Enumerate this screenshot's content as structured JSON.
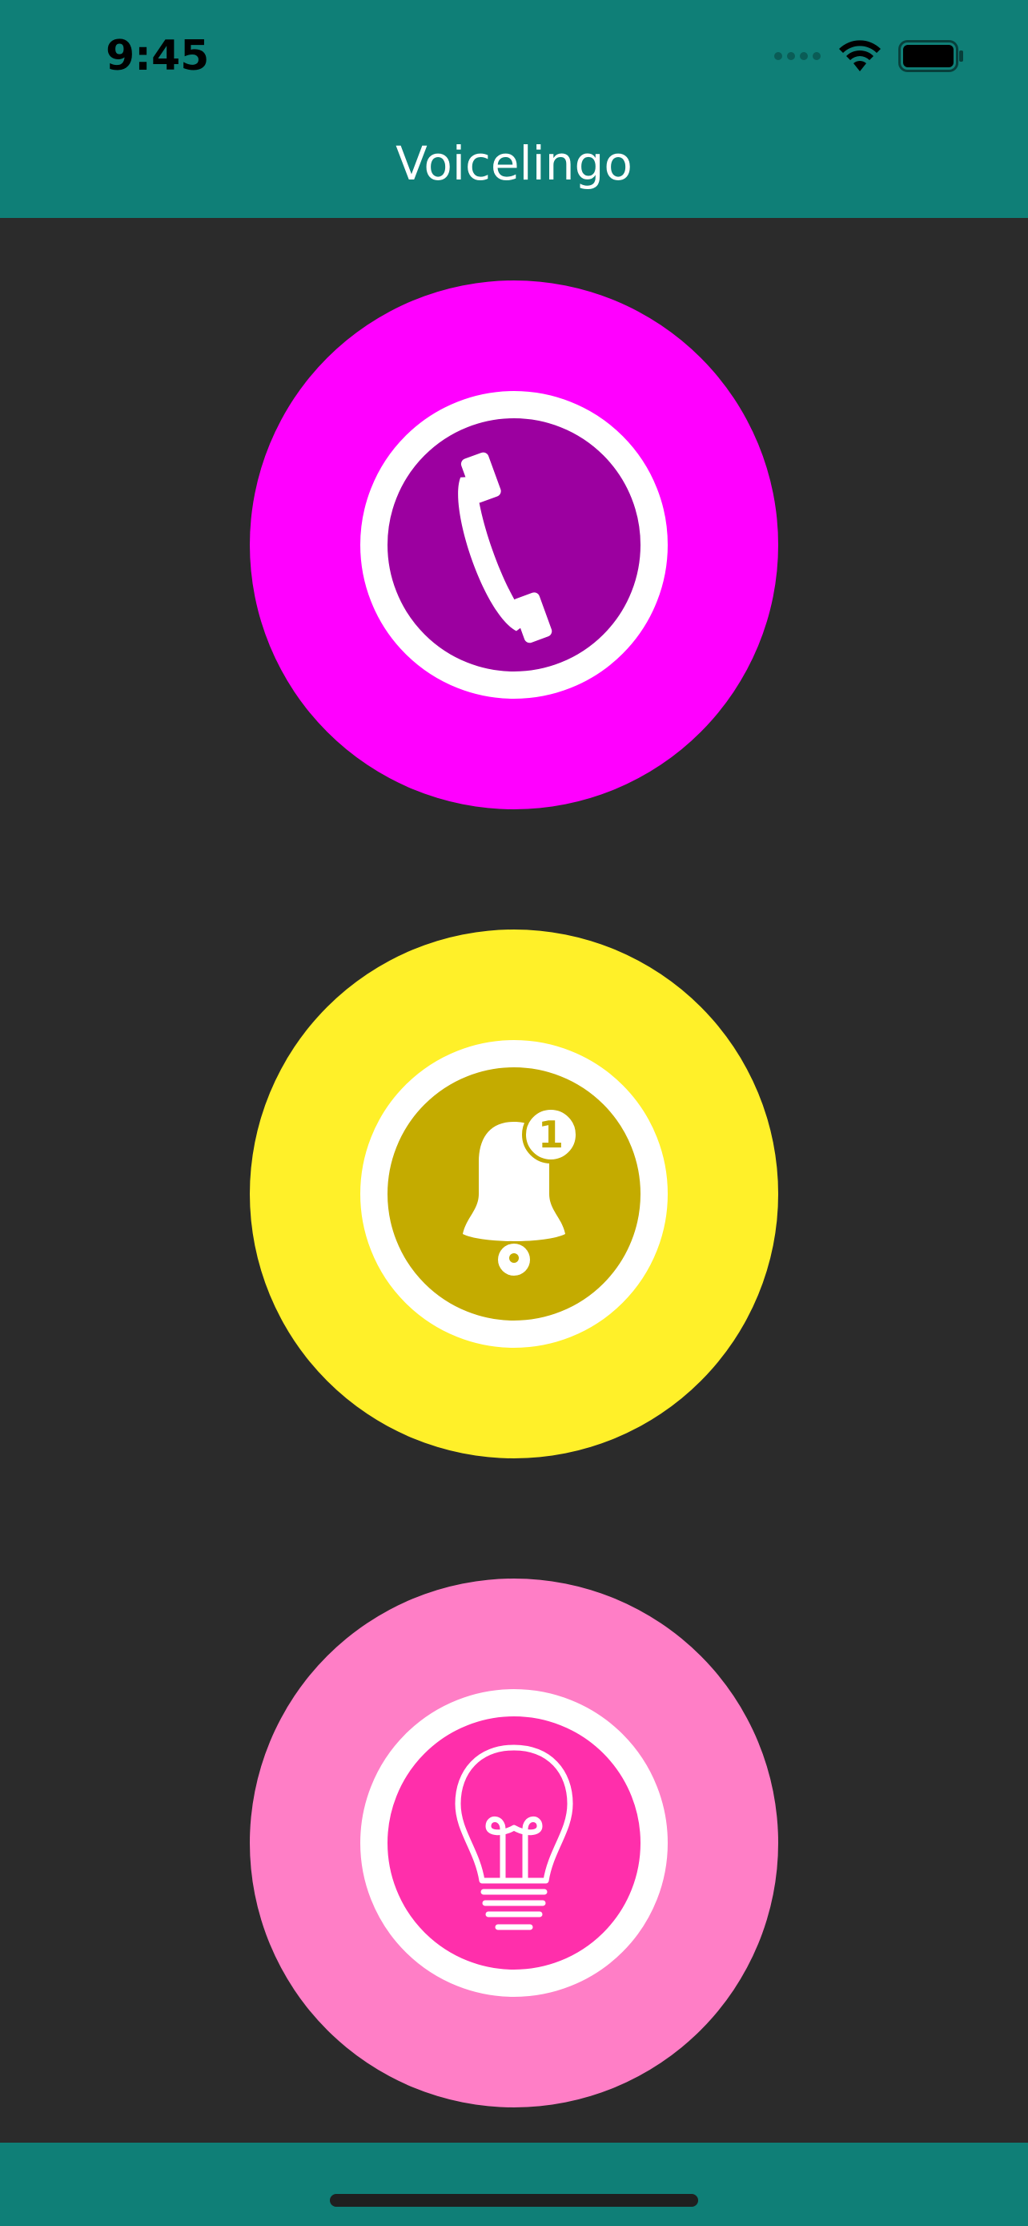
{
  "status_bar": {
    "time": "9:45",
    "icons": [
      "signal-dots-icon",
      "wifi-icon",
      "battery-icon"
    ]
  },
  "header": {
    "title": "Voicelingo",
    "background_color": "#0f7f77"
  },
  "buttons": [
    {
      "name": "call",
      "icon": "phone-icon",
      "outer_color": "#ff00ff",
      "inner_color": "#9c00a0"
    },
    {
      "name": "notifications",
      "icon": "bell-icon",
      "badge": "1",
      "outer_color": "#fff029",
      "inner_color": "#c4ab00"
    },
    {
      "name": "ideas",
      "icon": "lightbulb-icon",
      "outer_color": "#ff7ec6",
      "inner_color": "#ff2fab"
    }
  ],
  "colors": {
    "background": "#2b2b2b",
    "ring": "#ffffff"
  }
}
